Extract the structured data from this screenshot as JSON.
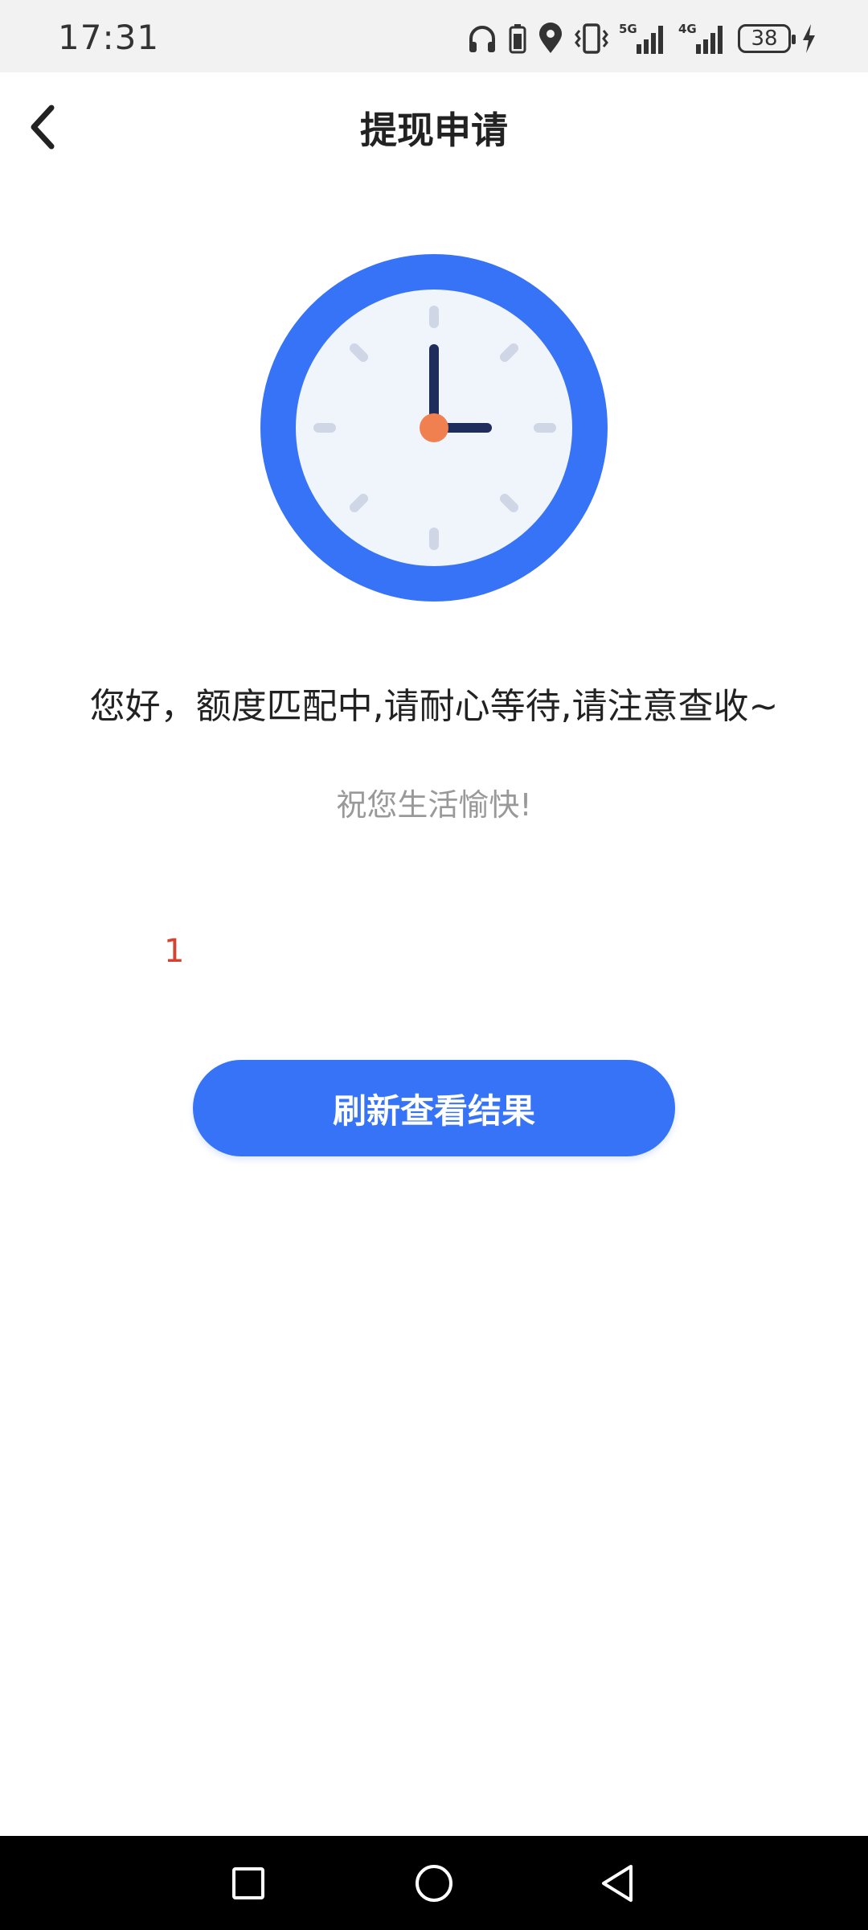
{
  "status_bar": {
    "time": "17:31",
    "battery_level": "38",
    "network_5g": "5G",
    "network_4g": "4G",
    "icons": [
      "headphones-icon",
      "battery-saver-icon",
      "location-icon",
      "vibrate-icon",
      "signal-5g-icon",
      "signal-4g-icon",
      "battery-icon",
      "charging-icon"
    ]
  },
  "nav": {
    "title": "提现申请",
    "back_icon": "chevron-left-icon"
  },
  "clock": {
    "icon": "clock-icon",
    "ring_color": "#3773f6",
    "face_color": "#f0f4fb",
    "hand_color": "#1f2d5c",
    "center_color": "#f08050"
  },
  "main": {
    "message": "您好，额度匹配中,请耐心等待,请注意查收~",
    "sub_message": "祝您生活愉快!",
    "counter": "1",
    "refresh_label": "刷新查看结果"
  },
  "system_nav": {
    "icons": [
      "recent-apps-icon",
      "home-icon",
      "back-icon"
    ]
  },
  "colors": {
    "accent": "#3773f6",
    "counter": "#d9412f"
  }
}
